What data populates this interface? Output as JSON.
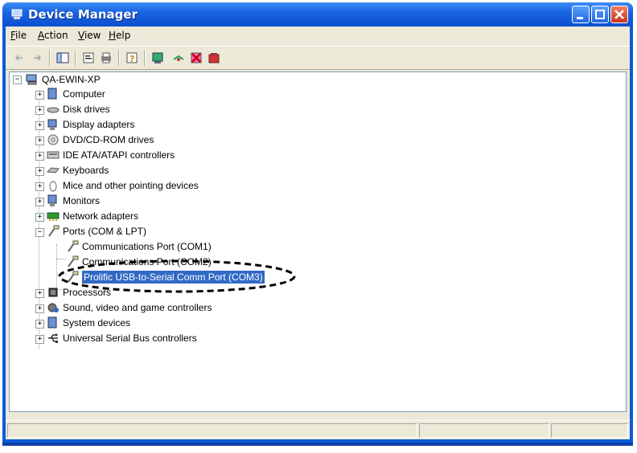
{
  "window": {
    "title": "Device Manager"
  },
  "menu": [
    {
      "label": "File",
      "accel": "F",
      "rest": "ile"
    },
    {
      "label": "Action",
      "accel": "A",
      "rest": "ction"
    },
    {
      "label": "View",
      "accel": "V",
      "rest": "iew"
    },
    {
      "label": "Help",
      "accel": "H",
      "rest": "elp"
    }
  ],
  "tree": {
    "root": "QA-EWIN-XP",
    "items": [
      {
        "label": "Computer",
        "icon": "computer-icon",
        "expander": "+"
      },
      {
        "label": "Disk drives",
        "icon": "disk-drive-icon",
        "expander": "+"
      },
      {
        "label": "Display adapters",
        "icon": "display-adapter-icon",
        "expander": "+"
      },
      {
        "label": "DVD/CD-ROM drives",
        "icon": "cdrom-icon",
        "expander": "+"
      },
      {
        "label": "IDE ATA/ATAPI controllers",
        "icon": "ide-controller-icon",
        "expander": "+"
      },
      {
        "label": "Keyboards",
        "icon": "keyboard-icon",
        "expander": "+"
      },
      {
        "label": "Mice and other pointing devices",
        "icon": "mouse-icon",
        "expander": "+"
      },
      {
        "label": "Monitors",
        "icon": "monitor-icon",
        "expander": "+"
      },
      {
        "label": "Network adapters",
        "icon": "network-adapter-icon",
        "expander": "+"
      },
      {
        "label": "Ports (COM & LPT)",
        "icon": "port-icon",
        "expander": "−"
      }
    ],
    "ports": [
      {
        "label": "Communications Port (COM1)"
      },
      {
        "label": "Communications Port (COM2)"
      },
      {
        "label": "Prolific USB-to-Serial Comm Port (COM3)",
        "selected": true
      }
    ],
    "after": [
      {
        "label": "Processors",
        "icon": "processor-icon",
        "expander": "+"
      },
      {
        "label": "Sound, video and game controllers",
        "icon": "sound-icon",
        "expander": "+"
      },
      {
        "label": "System devices",
        "icon": "system-device-icon",
        "expander": "+"
      },
      {
        "label": "Universal Serial Bus controllers",
        "icon": "usb-icon",
        "expander": "+"
      }
    ]
  },
  "colors": {
    "selection": "#316ac5",
    "highlight_ring": "#000000"
  }
}
